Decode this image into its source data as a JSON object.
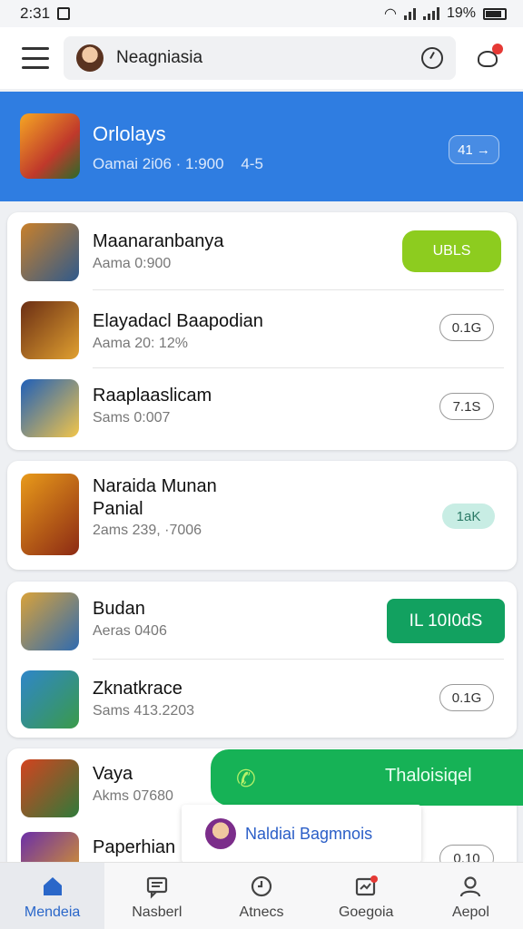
{
  "status_bar": {
    "time": "2:31",
    "battery": "19%"
  },
  "search": {
    "text": "Neagniasia"
  },
  "featured": {
    "title": "Orlolays",
    "subtitle": "Oamai 2i06 · 1:900",
    "rating": "4-5",
    "action": "41 →"
  },
  "group1": [
    {
      "name": "Maanaranbanya",
      "sub": "Aama 0:900",
      "action": "UBLS",
      "style": "lime",
      "icon_colors": [
        "#c9802a",
        "#2f5a8c"
      ]
    },
    {
      "name": "Elayadacl Baapodian",
      "sub": "Aama 20: 12%",
      "action": "0.1G",
      "style": "outline",
      "icon_colors": [
        "#6b2e14",
        "#e0a030"
      ]
    },
    {
      "name": "Raaplaaslicam",
      "sub": "Sams 0:007",
      "action": "7.1S",
      "style": "outline",
      "icon_colors": [
        "#1f5fb8",
        "#f2c54a"
      ]
    }
  ],
  "group2": [
    {
      "name": "Naraida Munan Panial",
      "sub": "2ams 239, ·7006",
      "action": "1aK",
      "style": "mint",
      "icon_colors": [
        "#e89a1a",
        "#8c2a14"
      ]
    }
  ],
  "group3": [
    {
      "name": "Budan",
      "sub": "Aeras 0406",
      "action": "IL 10I0dS",
      "style": "green",
      "icon_colors": [
        "#d9a23a",
        "#2f6bb0"
      ]
    },
    {
      "name": "Zknatkrace",
      "sub": "Sams 413.2203",
      "action": "0.1G",
      "style": "outline",
      "icon_colors": [
        "#2f86c9",
        "#3a9a4a"
      ]
    }
  ],
  "group4": [
    {
      "name": "Vaya",
      "sub": "Akms 07680",
      "icon_colors": [
        "#d3431f",
        "#2f7a3a"
      ]
    },
    {
      "name": "Paperhian",
      "sub": "",
      "action": "0.10",
      "style": "outline",
      "icon_colors": [
        "#6b2fa8",
        "#e0a020"
      ]
    }
  ],
  "fab": {
    "label": "Thaloisiqel",
    "icon": "phone-icon"
  },
  "popup": {
    "text": "Naldiai Bagmnois"
  },
  "bottom_nav": [
    {
      "label": "Mendeia",
      "icon": "home-icon",
      "active": true
    },
    {
      "label": "Nasberl",
      "icon": "message-icon",
      "active": false
    },
    {
      "label": "Atnecs",
      "icon": "clock-icon",
      "active": false
    },
    {
      "label": "Goegoia",
      "icon": "notification-icon",
      "active": false
    },
    {
      "label": "Aepol",
      "icon": "person-icon",
      "active": false
    }
  ]
}
